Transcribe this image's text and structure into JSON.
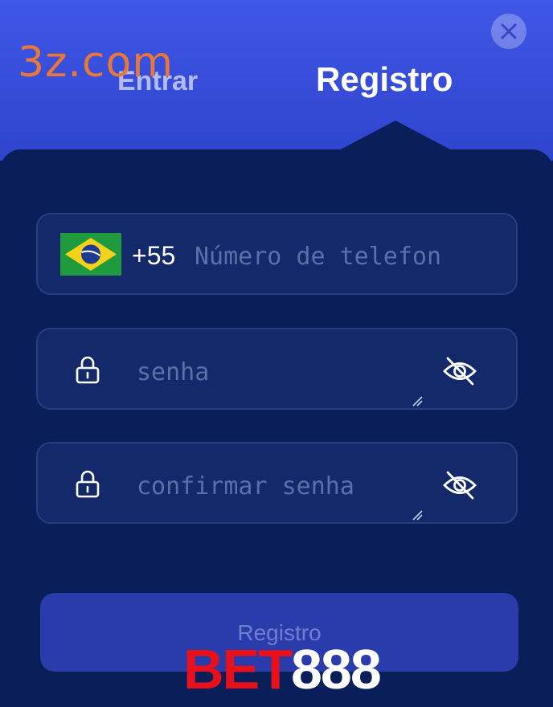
{
  "watermark": "3z.com",
  "tabs": {
    "login_label": "Entrar",
    "register_label": "Registro"
  },
  "phone_field": {
    "country_code": "+55",
    "placeholder": "Número de telefon",
    "flag": "brazil-flag"
  },
  "password_field": {
    "placeholder": "senha",
    "icons": [
      "lock-icon",
      "eye-off-icon"
    ]
  },
  "confirm_field": {
    "placeholder": "confirmar senha",
    "icons": [
      "lock-icon",
      "eye-off-icon"
    ]
  },
  "submit": {
    "label": "Registro"
  },
  "logo": {
    "part1": "BET",
    "part2": "888"
  },
  "colors": {
    "header_blue": "#3f57e8",
    "panel_navy": "#0a1f5a",
    "field_bg": "#13296a",
    "button_blue": "#2a3cab",
    "watermark_orange": "#e8773a",
    "logo_red": "#e8101a"
  }
}
